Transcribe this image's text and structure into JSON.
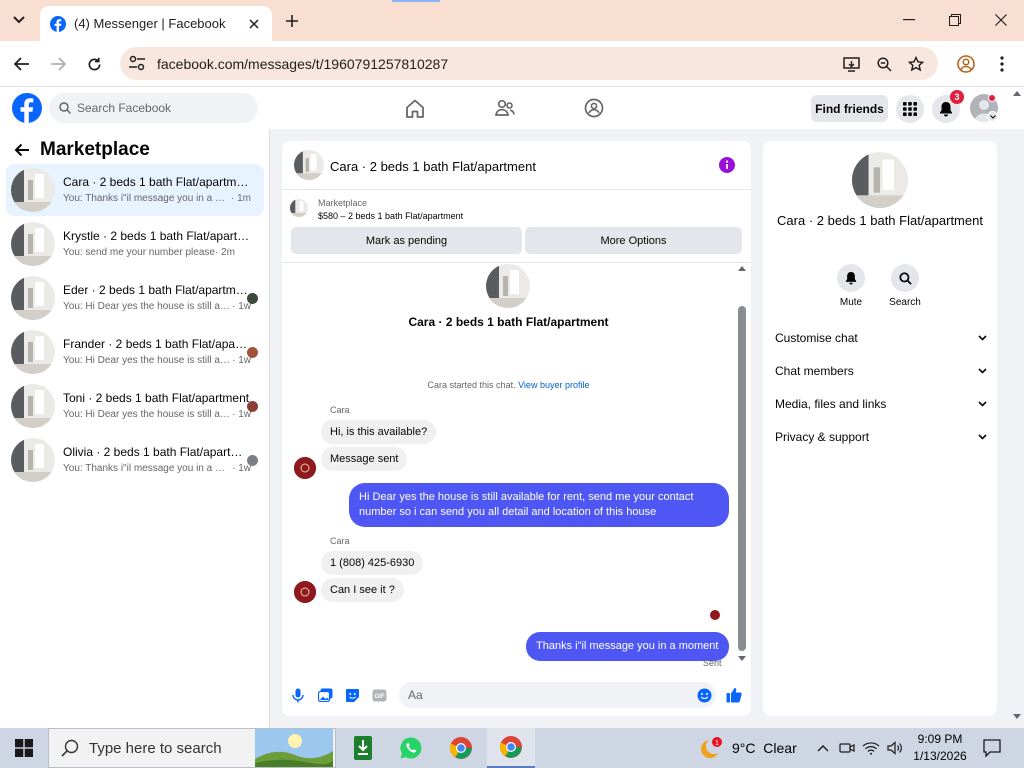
{
  "browser": {
    "tab_title": "(4) Messenger | Facebook",
    "url": "facebook.com/messages/t/1960791257810287"
  },
  "fb": {
    "search_placeholder": "Search Facebook",
    "find_friends": "Find friends",
    "notification_count": "3",
    "brand_color": "#0866ff"
  },
  "sidebar": {
    "title": "Marketplace",
    "conversations": [
      {
        "name": "Cara · 2 beds 1 bath Flat/apartment",
        "preview": "You: Thanks i\"il message you in a moment",
        "time": " · 1m",
        "active": true
      },
      {
        "name": "Krystle · 2 beds 1 bath Flat/apartment",
        "preview": "You: send me your number please",
        "time": " · 2m",
        "active": false
      },
      {
        "name": "Eder · 2 beds 1 bath Flat/apartment",
        "preview": "You: Hi Dear yes the house is still available for rent",
        "time": " · 1w",
        "active": false
      },
      {
        "name": "Frander · 2 beds 1 bath Flat/apartment",
        "preview": "You: Hi Dear yes the house is still available for rent",
        "time": " · 1w",
        "active": false
      },
      {
        "name": "Toni · 2 beds 1 bath Flat/apartment",
        "preview": "You: Hi Dear yes the house is still available for rent",
        "time": " · 1w",
        "active": false
      },
      {
        "name": "Olivia · 2 beds 1 bath Flat/apartment",
        "preview": "You: Thanks i\"il message you in a moment",
        "time": " · 1w",
        "active": false
      }
    ]
  },
  "chat": {
    "header_name": "Cara · 2 beds 1 bath Flat/apartment",
    "marketplace_label": "Marketplace",
    "listing": "$580 – 2 beds 1 bath Flat/apartment",
    "mark_pending": "Mark as pending",
    "more_options": "More Options",
    "intro_name": "Cara · 2 beds 1 bath Flat/apartment",
    "started_text": "Cara started this chat.",
    "view_profile": "View buyer profile",
    "sender_name": "Cara",
    "messages": {
      "m1": "Hi, is this available?",
      "m2": "Message sent",
      "m3": "Hi Dear yes the house is still available for rent, send me your contact number so i can send you all detail and location of this house",
      "m4": "1 (808) 425-6930",
      "m5": "Can I see it ?",
      "m6": "Thanks i\"il message you in a moment"
    },
    "sent_label": "Sent",
    "composer_placeholder": "Aa",
    "outgoing_color": "#4e57f4"
  },
  "info": {
    "name": "Cara · 2 beds 1 bath Flat/apartment",
    "mute": "Mute",
    "search": "Search",
    "sections": [
      "Customise chat",
      "Chat members",
      "Media, files and links",
      "Privacy & support"
    ]
  },
  "taskbar": {
    "search_placeholder": "Type here to search",
    "weather": "9°C  Clear",
    "weather_badge": "1",
    "time": "9:09 PM",
    "date": "1/13/2026"
  }
}
